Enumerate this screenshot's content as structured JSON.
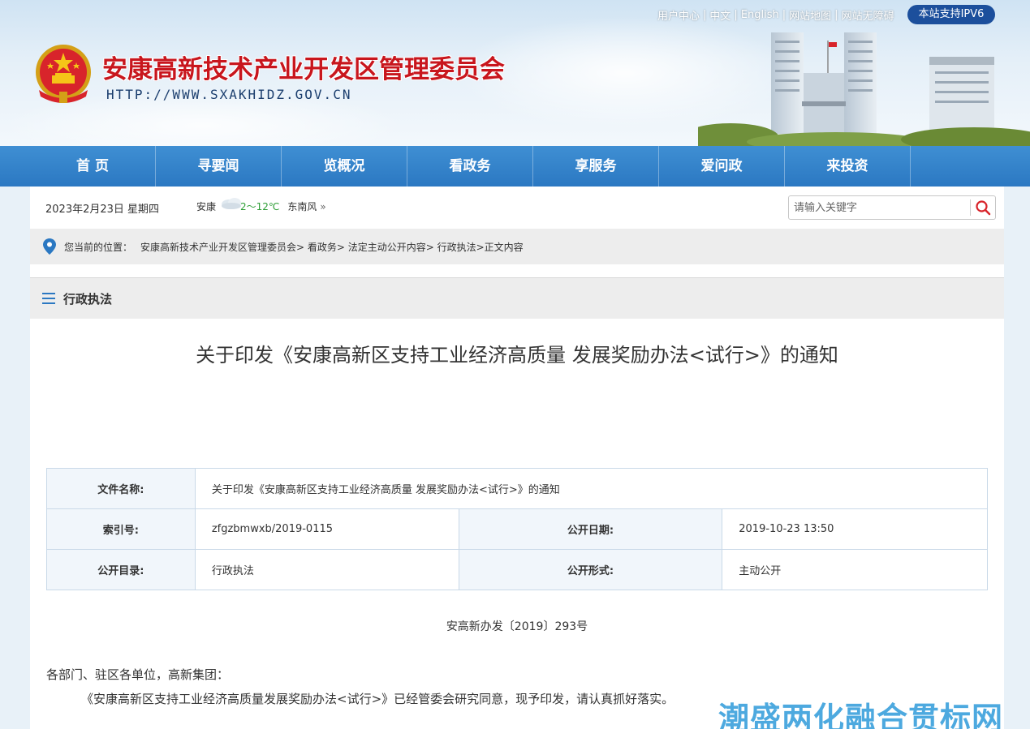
{
  "header": {
    "site_title": "安康高新技术产业开发区管理委员会",
    "site_url": "HTTP://WWW.SXAKHIDZ.GOV.CN",
    "top_links": [
      "用户中心",
      "中文",
      "English",
      "网站地图",
      "网站无障碍"
    ],
    "ipv6_badge": "本站支持IPV6"
  },
  "nav": {
    "items": [
      "首 页",
      "寻要闻",
      "览概况",
      "看政务",
      "享服务",
      "爱问政",
      "来投资"
    ]
  },
  "infobar": {
    "date": "2023年2月23日 星期四",
    "weather_city": "安康",
    "weather_temp": "2～12℃",
    "weather_wind": "东南风",
    "weather_more": "»",
    "search_placeholder": "请输入关键字"
  },
  "breadcrumb": {
    "label": "您当前的位置：",
    "path": "安康高新技术产业开发区管理委员会> 看政务> 法定主动公开内容> 行政执法>正文内容"
  },
  "section": {
    "title": "行政执法"
  },
  "article": {
    "title": "关于印发《安康高新区支持工业经济高质量 发展奖励办法<试行>》的通知",
    "meta": {
      "file_name_label": "文件名称:",
      "file_name": "关于印发《安康高新区支持工业经济高质量 发展奖励办法<试行>》的通知",
      "index_label": "索引号:",
      "index": "zfgzbmwxb/2019-0115",
      "pub_date_label": "公开日期:",
      "pub_date": "2019-10-23 13:50",
      "catalog_label": "公开目录:",
      "catalog": "行政执法",
      "form_label": "公开形式:",
      "form": "主动公开"
    },
    "doc_no": "安高新办发〔2019〕293号",
    "para1": "各部门、驻区各单位，高新集团：",
    "para2": "《安康高新区支持工业经济高质量发展奖励办法<试行>》已经管委会研究同意，现予印发，请认真抓好落实。"
  },
  "watermark": "潮盛两化融合贯标网",
  "colors": {
    "nav_blue": "#2b78c2",
    "title_red": "#c8161d",
    "badge_blue": "#1c4f9c",
    "watermark_blue": "#3aa0dc"
  }
}
